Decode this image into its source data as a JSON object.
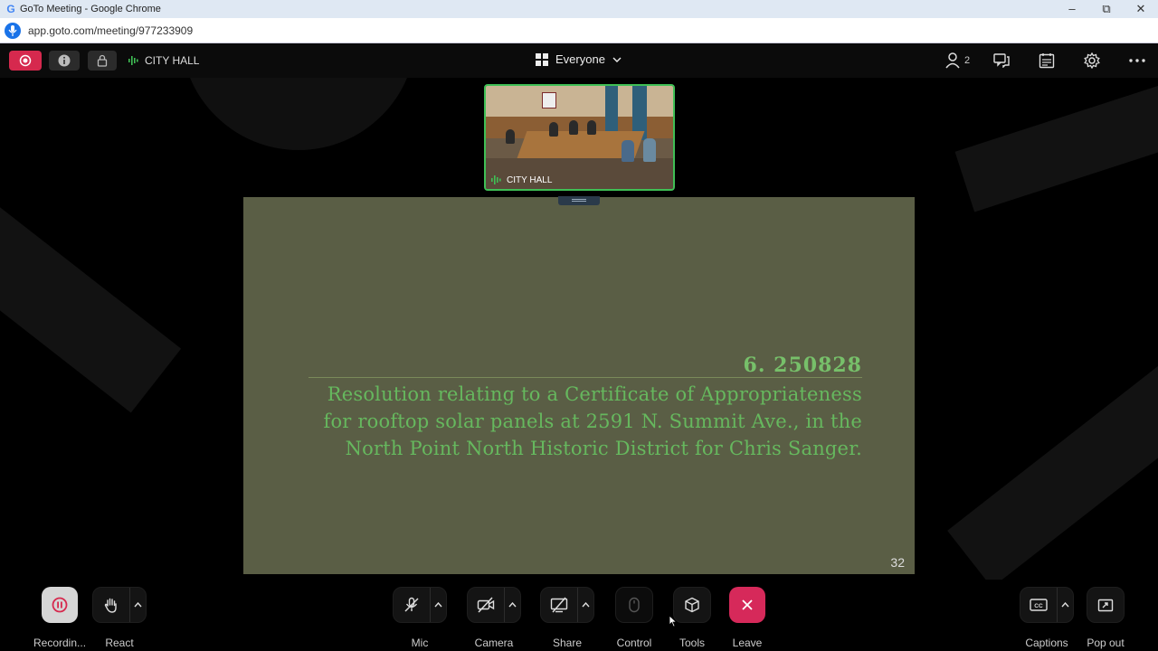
{
  "browser": {
    "window_title": "GoTo Meeting - Google Chrome",
    "url": "app.goto.com/meeting/977233909"
  },
  "topbar": {
    "room_name": "CITY HALL",
    "view_label": "Everyone",
    "participant_count": "2"
  },
  "video": {
    "tile_name": "CITY HALL"
  },
  "slide": {
    "item_number": "6. 250828",
    "line1": "Resolution relating to a Certificate of Appropriateness",
    "line2": "for rooftop solar panels at 2591 N. Summit Ave., in the",
    "line3": "North Point North Historic District for Chris Sanger.",
    "page_number": "32"
  },
  "controls": {
    "recording": "Recordin...",
    "react": "React",
    "mic": "Mic",
    "camera": "Camera",
    "share": "Share",
    "control": "Control",
    "tools": "Tools",
    "leave": "Leave",
    "captions": "Captions",
    "popout": "Pop out"
  },
  "colors": {
    "accent_red": "#d6294e",
    "speaking_green": "#3fbf55",
    "slide_bg": "#5a5e45",
    "slide_text": "#66b85e"
  }
}
